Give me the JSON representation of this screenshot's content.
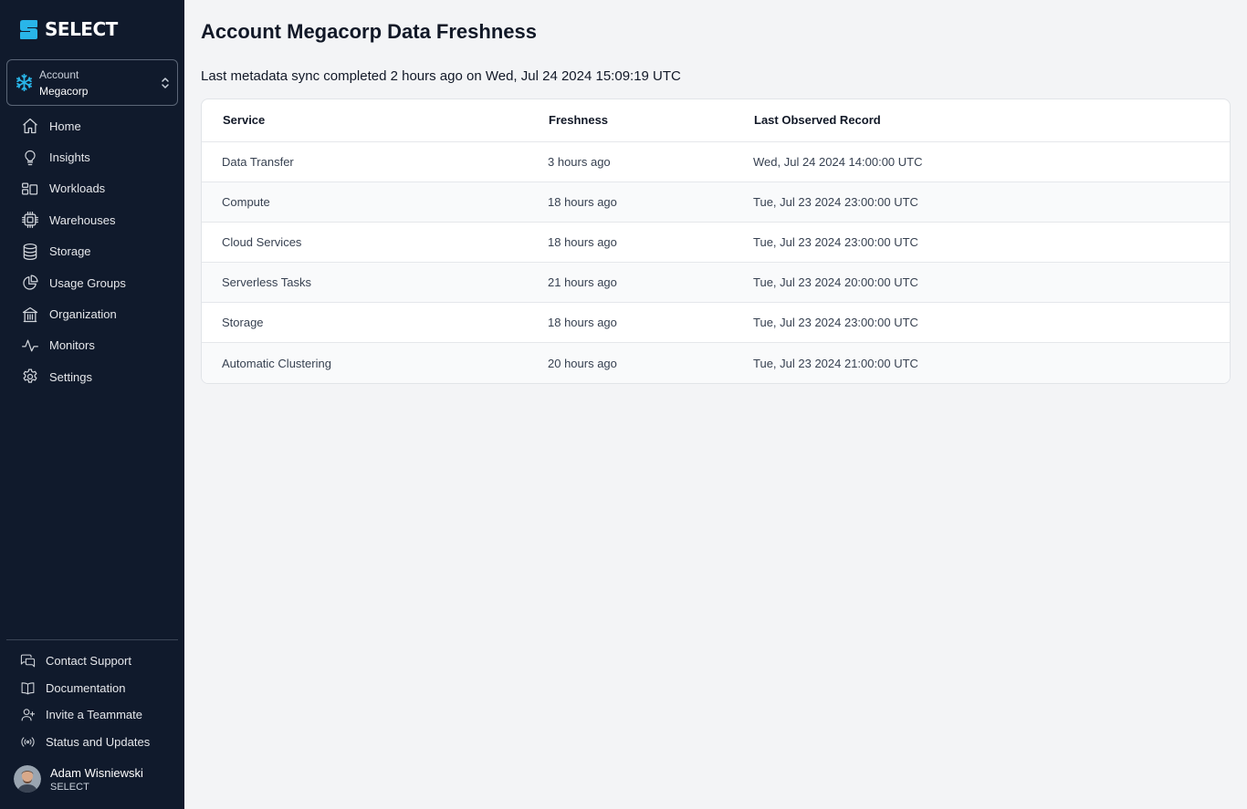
{
  "app": {
    "brand": "SELECT",
    "accent": "#29b5e8",
    "sidebar_bg": "#101a2c"
  },
  "account": {
    "label": "Account",
    "name": "Megacorp",
    "icon": "snowflake-icon"
  },
  "nav": [
    {
      "label": "Home",
      "icon": "home-icon"
    },
    {
      "label": "Insights",
      "icon": "lightbulb-icon"
    },
    {
      "label": "Workloads",
      "icon": "workloads-icon"
    },
    {
      "label": "Warehouses",
      "icon": "cpu-chip-icon"
    },
    {
      "label": "Storage",
      "icon": "database-icon"
    },
    {
      "label": "Usage Groups",
      "icon": "pie-chart-icon"
    },
    {
      "label": "Organization",
      "icon": "building-icon"
    },
    {
      "label": "Monitors",
      "icon": "pulse-icon"
    },
    {
      "label": "Settings",
      "icon": "gear-icon"
    }
  ],
  "bottom_nav": [
    {
      "label": "Contact Support",
      "icon": "chat-bubbles-icon"
    },
    {
      "label": "Documentation",
      "icon": "book-icon"
    },
    {
      "label": "Invite a Teammate",
      "icon": "user-plus-icon"
    },
    {
      "label": "Status and Updates",
      "icon": "broadcast-icon"
    }
  ],
  "user": {
    "name": "Adam Wisniewski",
    "org": "SELECT"
  },
  "page": {
    "title": "Account Megacorp Data Freshness",
    "sync_text": "Last metadata sync completed 2 hours ago on Wed, Jul 24 2024 15:09:19 UTC"
  },
  "table": {
    "headers": {
      "service": "Service",
      "freshness": "Freshness",
      "last": "Last Observed Record"
    },
    "rows": [
      {
        "service": "Data Transfer",
        "freshness": "3 hours ago",
        "last": "Wed, Jul 24 2024 14:00:00 UTC"
      },
      {
        "service": "Compute",
        "freshness": "18 hours ago",
        "last": "Tue, Jul 23 2024 23:00:00 UTC"
      },
      {
        "service": "Cloud Services",
        "freshness": "18 hours ago",
        "last": "Tue, Jul 23 2024 23:00:00 UTC"
      },
      {
        "service": "Serverless Tasks",
        "freshness": "21 hours ago",
        "last": "Tue, Jul 23 2024 20:00:00 UTC"
      },
      {
        "service": "Storage",
        "freshness": "18 hours ago",
        "last": "Tue, Jul 23 2024 23:00:00 UTC"
      },
      {
        "service": "Automatic Clustering",
        "freshness": "20 hours ago",
        "last": "Tue, Jul 23 2024 21:00:00 UTC"
      }
    ]
  }
}
